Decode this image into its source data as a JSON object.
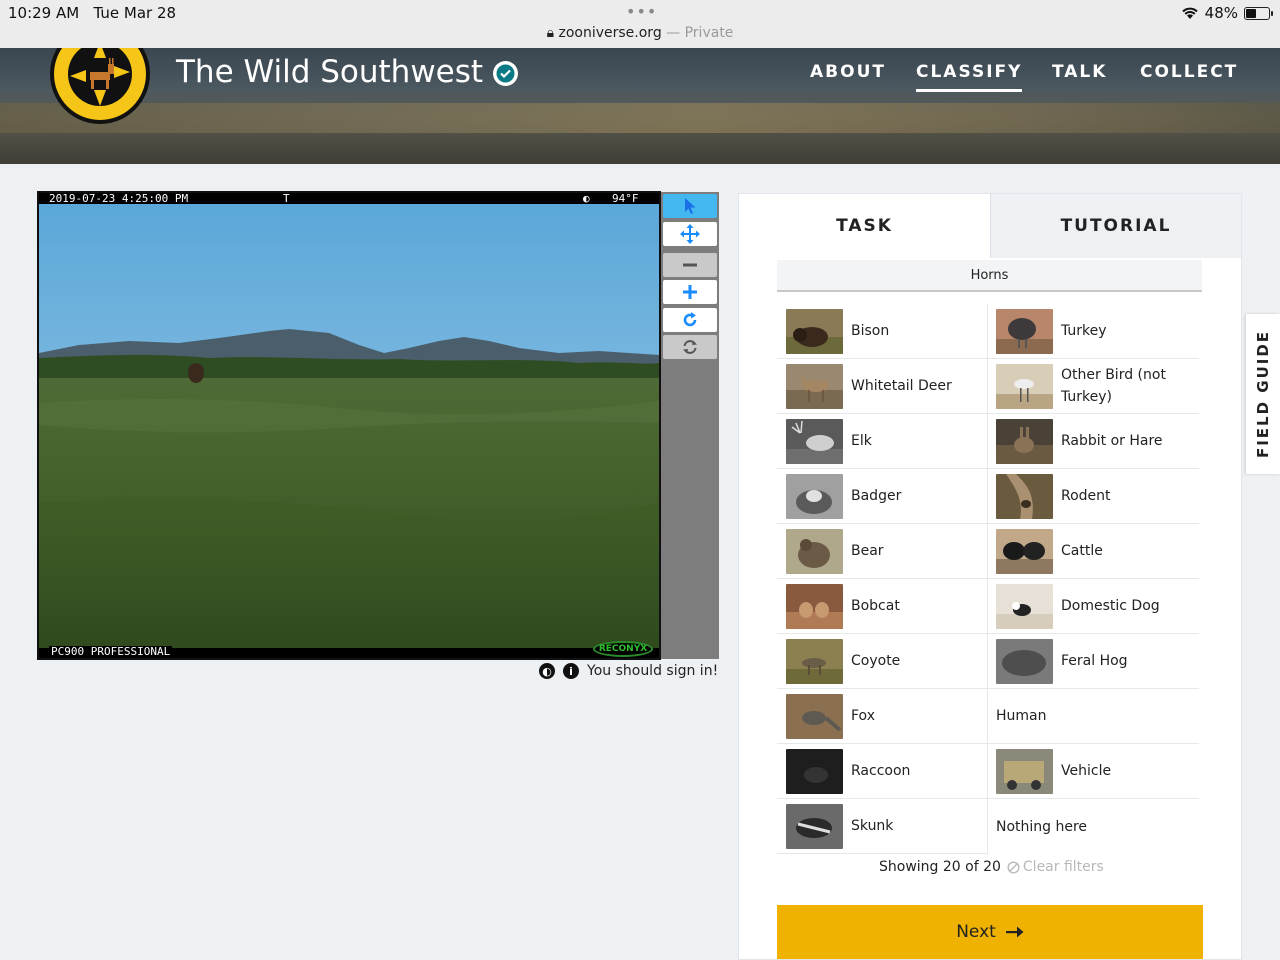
{
  "status_bar": {
    "time": "10:29 AM",
    "date": "Tue Mar 28",
    "url": "zooniverse.org",
    "private_label": "— Private",
    "battery": "48%"
  },
  "header": {
    "project_title": "The Wild Southwest",
    "nav": {
      "about": "ABOUT",
      "classify": "CLASSIFY",
      "talk": "TALK",
      "collect": "COLLECT"
    }
  },
  "viewer": {
    "stamp_date": "2019-07-23 4:25:00 PM",
    "stamp_mode": "T",
    "stamp_temp": "94°F",
    "camera_model": "PC900 PROFESSIONAL",
    "camera_brand": "RECONYX",
    "sign_in_message": "You should sign in!"
  },
  "panel": {
    "tabs": {
      "task": "TASK",
      "tutorial": "TUTORIAL"
    },
    "filter_label": "Horns",
    "choices": [
      {
        "label": "Bison"
      },
      {
        "label": "Turkey"
      },
      {
        "label": "Whitetail Deer"
      },
      {
        "label": "Other Bird (not Turkey)"
      },
      {
        "label": "Elk"
      },
      {
        "label": "Rabbit or Hare"
      },
      {
        "label": "Badger"
      },
      {
        "label": "Rodent"
      },
      {
        "label": "Bear"
      },
      {
        "label": "Cattle"
      },
      {
        "label": "Bobcat"
      },
      {
        "label": "Domestic Dog"
      },
      {
        "label": "Coyote"
      },
      {
        "label": "Feral Hog"
      },
      {
        "label": "Fox"
      },
      {
        "label": "Human"
      },
      {
        "label": "Raccoon"
      },
      {
        "label": "Vehicle"
      },
      {
        "label": "Skunk"
      },
      {
        "label": "Nothing here"
      }
    ],
    "showing": "Showing 20 of 20",
    "clear_filters": "Clear filters",
    "next": "Next"
  },
  "field_guide": "FIELD GUIDE",
  "colors": {
    "accent_yellow": "#f0b200",
    "tool_blue": "#1a8cff",
    "logo_yellow": "#f5c518"
  }
}
